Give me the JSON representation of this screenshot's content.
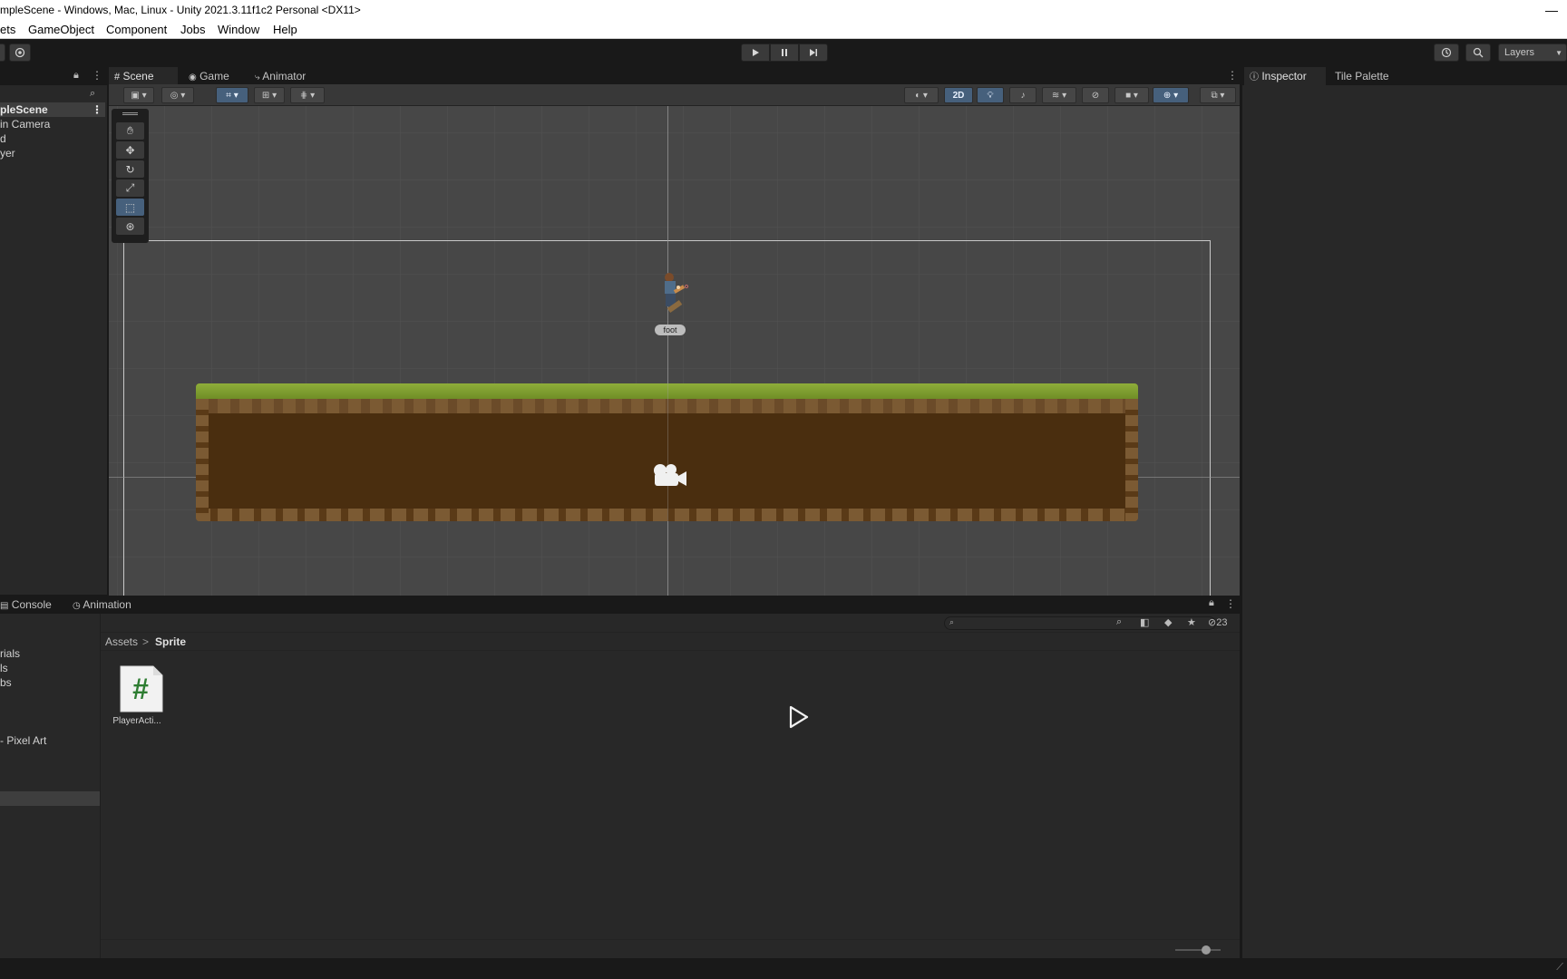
{
  "window": {
    "title": "mpleScene - Windows, Mac, Linux - Unity 2021.3.11f1c2 Personal <DX11>",
    "minimize": "—"
  },
  "menu": [
    "ets",
    "GameObject",
    "Component",
    "Jobs",
    "Window",
    "Help"
  ],
  "toolbar": {
    "layers_label": "Layers"
  },
  "hierarchy": {
    "scene_name": "pleScene",
    "items": [
      "in Camera",
      "d",
      "yer"
    ]
  },
  "scene_tabs": [
    {
      "label": "Scene",
      "icon": "grid-icon"
    },
    {
      "label": "Game",
      "icon": "gamepad-icon"
    },
    {
      "label": "Animator",
      "icon": "animator-icon"
    }
  ],
  "scene_toolbar": {
    "mode_2d": "2D"
  },
  "scene": {
    "player_label": "foot"
  },
  "bottom_tabs": [
    {
      "label": "Console",
      "icon": "console-icon"
    },
    {
      "label": "Animation",
      "icon": "animation-icon"
    }
  ],
  "project": {
    "folders": [
      "rials",
      "ls",
      "bs",
      "- Pixel Art"
    ],
    "breadcrumb": [
      "Assets",
      "Sprite"
    ],
    "breadcrumb_sep": ">",
    "hidden_count": "23",
    "files": [
      {
        "name": "PlayerActi...",
        "type": "csharp-script"
      }
    ]
  },
  "inspector_tabs": [
    {
      "label": "Inspector",
      "icon": "info-icon"
    },
    {
      "label": "Tile Palette",
      "icon": ""
    }
  ],
  "colors": {
    "accent": "#46607c",
    "panel": "#282828",
    "scene_bg": "#474747",
    "grass": "#8fae3a",
    "dirt": "#4a2e0f",
    "script_icon_green": "#2e7d32"
  }
}
